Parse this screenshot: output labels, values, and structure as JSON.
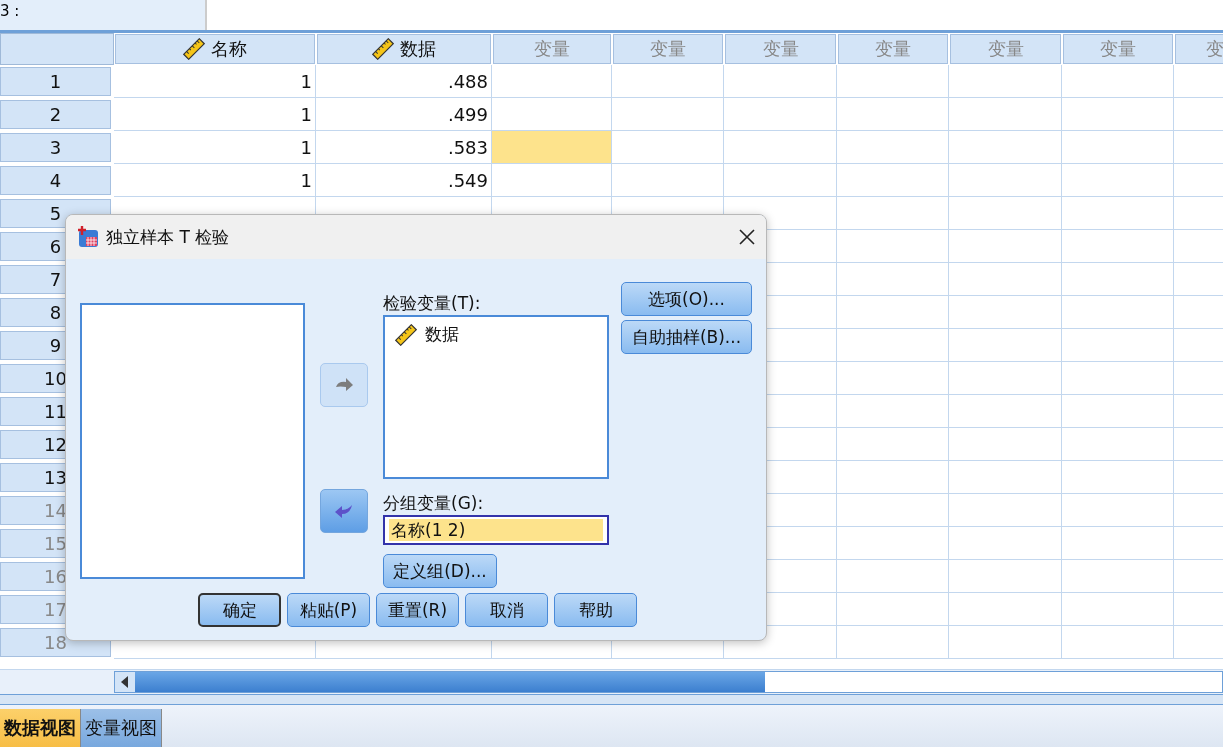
{
  "cell_ref": "3 :",
  "grid": {
    "columns": [
      {
        "label": "名称",
        "kind": "variable"
      },
      {
        "label": "数据",
        "kind": "variable"
      },
      {
        "label": "变量",
        "kind": "empty"
      },
      {
        "label": "变量",
        "kind": "empty"
      },
      {
        "label": "变量",
        "kind": "empty"
      },
      {
        "label": "变量",
        "kind": "empty"
      },
      {
        "label": "变量",
        "kind": "empty"
      },
      {
        "label": "变量",
        "kind": "empty"
      },
      {
        "label": "变",
        "kind": "empty"
      }
    ],
    "rows": [
      {
        "number": "1",
        "has_data": true,
        "cells": [
          {
            "text": "1",
            "selected": false
          },
          {
            "text": ".488",
            "selected": false
          }
        ]
      },
      {
        "number": "2",
        "has_data": true,
        "cells": [
          {
            "text": "1",
            "selected": false
          },
          {
            "text": ".499",
            "selected": false
          }
        ]
      },
      {
        "number": "3",
        "has_data": true,
        "cells": [
          {
            "text": "1",
            "selected": false
          },
          {
            "text": ".583",
            "selected": false
          },
          {
            "selected": true
          }
        ]
      },
      {
        "number": "4",
        "has_data": true,
        "cells": [
          {
            "text": "1",
            "selected": false
          },
          {
            "text": ".549",
            "selected": false
          }
        ]
      },
      {
        "number": "5",
        "has_data": true
      },
      {
        "number": "6",
        "has_data": true
      },
      {
        "number": "7",
        "has_data": true
      },
      {
        "number": "8",
        "has_data": true
      },
      {
        "number": "9",
        "has_data": true
      },
      {
        "number": "10",
        "has_data": true
      },
      {
        "number": "11",
        "has_data": true
      },
      {
        "number": "12",
        "has_data": true
      },
      {
        "number": "13",
        "has_data": true
      },
      {
        "number": "14",
        "has_data": false
      },
      {
        "number": "15",
        "has_data": false
      },
      {
        "number": "16",
        "has_data": false
      },
      {
        "number": "17",
        "has_data": false
      },
      {
        "number": "18",
        "has_data": false
      }
    ]
  },
  "dialog": {
    "title": "独立样本 T 检验",
    "test_variables": {
      "label": "检验变量(T):",
      "items": [
        {
          "label": "数据"
        }
      ]
    },
    "move_buttons": [
      {
        "kind": "right",
        "disabled": true
      },
      {
        "kind": "left",
        "disabled": false
      }
    ],
    "grouping_variable": {
      "label": "分组变量(G):",
      "value": "名称(1 2)"
    },
    "define_groups_button": "定义组(D)...",
    "side_buttons": [
      "选项(O)...",
      "自助抽样(B)..."
    ],
    "buttons": [
      {
        "label": "确定",
        "default": true
      },
      {
        "label": "粘贴(P)",
        "default": false
      },
      {
        "label": "重置(R)",
        "default": false
      },
      {
        "label": "取消",
        "default": false
      },
      {
        "label": "帮助",
        "default": false
      }
    ]
  },
  "view_tabs": [
    {
      "label": "数据视图",
      "selected": true
    },
    {
      "label": "变量视图",
      "selected": false
    }
  ]
}
